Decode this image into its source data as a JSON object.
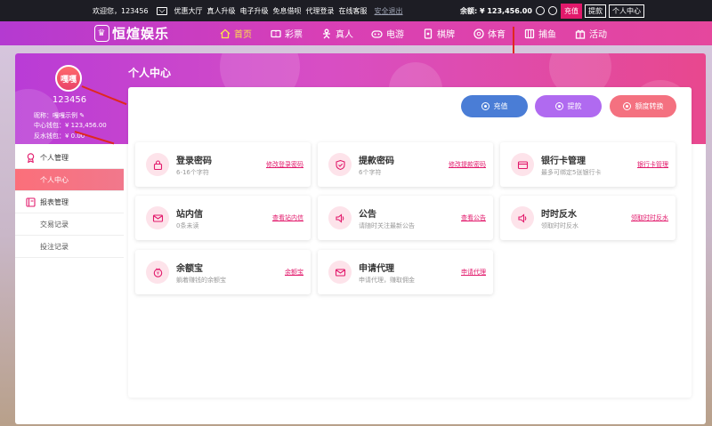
{
  "topbar": {
    "welcome": "欢迎您，123456",
    "links": [
      "优惠大厅",
      "真人升级",
      "电子升级",
      "免息借呗",
      "代理登录",
      "在线客服"
    ],
    "logout": "安全退出",
    "balance": "余额: ¥ 123,456.00",
    "recharge": "充值",
    "withdraw": "提款",
    "personal_center": "个人中心"
  },
  "nav": {
    "logo_text": "恒煊娱乐",
    "items": [
      {
        "label": "首页",
        "icon": "home-icon"
      },
      {
        "label": "彩票",
        "icon": "ticket-icon"
      },
      {
        "label": "真人",
        "icon": "person-icon"
      },
      {
        "label": "电游",
        "icon": "gamepad-icon"
      },
      {
        "label": "棋牌",
        "icon": "cards-icon"
      },
      {
        "label": "体育",
        "icon": "ball-icon"
      },
      {
        "label": "捕鱼",
        "icon": "fish-icon"
      },
      {
        "label": "活动",
        "icon": "gift-icon"
      }
    ]
  },
  "user": {
    "avatar_text": "嘎嘎",
    "name": "123456",
    "nickname": "昵称：嘎嘎示例",
    "center_wallet": "中心钱包：¥ 123,456.00",
    "rebate_wallet": "反水钱包：¥ 0.00"
  },
  "menu": {
    "groups": [
      {
        "label": "个人管理",
        "icon": "medal-icon",
        "items": [
          "个人中心"
        ]
      },
      {
        "label": "报表管理",
        "icon": "book-icon",
        "items": [
          "交易记录",
          "投注记录"
        ]
      }
    ]
  },
  "content": {
    "title": "个人中心",
    "actions": [
      {
        "label": "充值",
        "color": "#4a7dd6"
      },
      {
        "label": "提款",
        "color": "#b06af0"
      },
      {
        "label": "额度转换",
        "color": "#f47180"
      }
    ],
    "cards": [
      {
        "title": "登录密码",
        "sub": "6-16个字符",
        "link": "修改登录密码",
        "icon": "lock-icon"
      },
      {
        "title": "提款密码",
        "sub": "6个字符",
        "link": "修改提款密码",
        "icon": "shield-icon"
      },
      {
        "title": "银行卡管理",
        "sub": "最多可绑定5张银行卡",
        "link": "银行卡管理",
        "icon": "card-icon"
      },
      {
        "title": "站内信",
        "sub": "0条未读",
        "link": "查看站内信",
        "icon": "mail-icon"
      },
      {
        "title": "公告",
        "sub": "请随时关注最新公告",
        "link": "查看公告",
        "icon": "speaker-icon"
      },
      {
        "title": "时时反水",
        "sub": "领取时时反水",
        "link": "领取时时反水",
        "icon": "speaker-icon"
      },
      {
        "title": "余额宝",
        "sub": "躺着赚钱的余额宝",
        "link": "余额宝",
        "icon": "piggy-icon"
      },
      {
        "title": "申请代理",
        "sub": "申请代理，赚取佣金",
        "link": "申请代理",
        "icon": "mail-icon"
      }
    ]
  },
  "colors": {
    "accent": "#e2196b",
    "topbar_bg": "#1d1d24",
    "nav_gradient_start": "#b43ad1",
    "nav_gradient_end": "#e5479d"
  }
}
